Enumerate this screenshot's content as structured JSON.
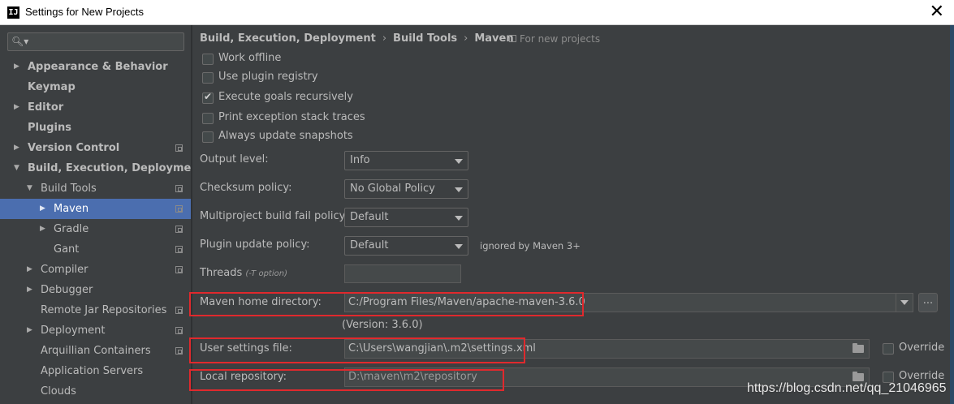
{
  "window": {
    "app_icon": "IJ",
    "title": "Settings for New Projects",
    "close": "✕"
  },
  "sidebar": {
    "search_placeholder": "",
    "items": [
      {
        "label": "Appearance & Behavior",
        "bold": true,
        "arrow": "▶"
      },
      {
        "label": "Keymap",
        "bold": true,
        "arrow": ""
      },
      {
        "label": "Editor",
        "bold": true,
        "arrow": "▶"
      },
      {
        "label": "Plugins",
        "bold": true,
        "arrow": ""
      },
      {
        "label": "Version Control",
        "bold": true,
        "arrow": "▶"
      },
      {
        "label": "Build, Execution, Deployment",
        "bold": true,
        "arrow": "▼"
      },
      {
        "label": "Build Tools",
        "bold": false,
        "arrow": "▼"
      },
      {
        "label": "Maven",
        "bold": false,
        "arrow": "▶",
        "selected": true
      },
      {
        "label": "Gradle",
        "bold": false,
        "arrow": "▶"
      },
      {
        "label": "Gant",
        "bold": false,
        "arrow": ""
      },
      {
        "label": "Compiler",
        "bold": false,
        "arrow": "▶"
      },
      {
        "label": "Debugger",
        "bold": false,
        "arrow": "▶"
      },
      {
        "label": "Remote Jar Repositories",
        "bold": false,
        "arrow": ""
      },
      {
        "label": "Deployment",
        "bold": false,
        "arrow": "▶"
      },
      {
        "label": "Arquillian Containers",
        "bold": false,
        "arrow": ""
      },
      {
        "label": "Application Servers",
        "bold": false,
        "arrow": ""
      },
      {
        "label": "Clouds",
        "bold": false,
        "arrow": ""
      }
    ]
  },
  "breadcrumb": {
    "items": [
      "Build, Execution, Deployment",
      "Build Tools",
      "Maven"
    ],
    "separator": "›",
    "note": "For new projects"
  },
  "checkboxes": [
    {
      "label": "Work offline",
      "checked": false
    },
    {
      "label": "Use plugin registry",
      "checked": false
    },
    {
      "label": "Execute goals recursively",
      "checked": true,
      "mark": "✔"
    },
    {
      "label": "Print exception stack traces",
      "checked": false
    },
    {
      "label": "Always update snapshots",
      "checked": false
    }
  ],
  "fields": {
    "output_level": {
      "label": "Output level:",
      "value": "Info"
    },
    "checksum_policy": {
      "label": "Checksum policy:",
      "value": "No Global Policy"
    },
    "multiproject_fail": {
      "label": "Multiproject build fail policy:",
      "value": "Default"
    },
    "plugin_update": {
      "label": "Plugin update policy:",
      "value": "Default",
      "note": "ignored by Maven 3+"
    },
    "threads": {
      "label": "Threads",
      "hint": "(-T option)",
      "value": ""
    },
    "maven_home": {
      "label": "Maven home directory:",
      "value": "C:/Program Files/Maven/apache-maven-3.6.0",
      "browse": "..."
    },
    "version": "(Version: 3.6.0)",
    "user_settings": {
      "label": "User settings file:",
      "value": "C:\\Users\\wangjian\\.m2\\settings.xml",
      "override": "Override"
    },
    "local_repo": {
      "label": "Local repository:",
      "value": "D:\\maven\\m2\\repository",
      "override": "Override"
    }
  },
  "watermark": "https://blog.csdn.net/qq_21046965",
  "colors": {
    "background": "#3c3f41",
    "selection": "#4b6eaf",
    "highlight_box": "#e0292d"
  }
}
